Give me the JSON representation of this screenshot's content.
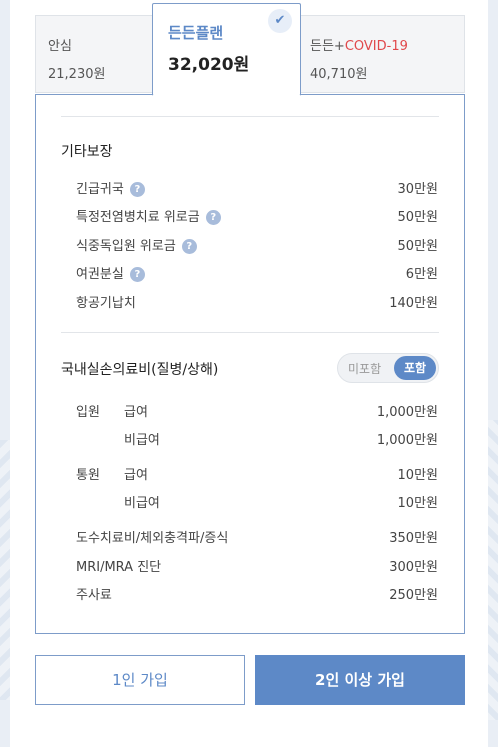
{
  "plans": [
    {
      "name": "안심",
      "price": "21,230원"
    },
    {
      "name": "든든플랜",
      "price": "32,020원",
      "selected": true
    },
    {
      "name_prefix": "든든+",
      "name_highlight": "COVID-19",
      "price": "40,710원"
    }
  ],
  "other": {
    "title": "기타보장",
    "items": [
      {
        "label": "긴급귀국",
        "value": "30만원",
        "help": "?"
      },
      {
        "label": "특정전염병치료 위로금",
        "value": "50만원",
        "help": "?"
      },
      {
        "label": "식중독입원 위로금",
        "value": "50만원",
        "help": "?"
      },
      {
        "label": "여권분실",
        "value": "6만원",
        "help": "?"
      },
      {
        "label": "항공기납치",
        "value": "140만원"
      }
    ]
  },
  "domestic": {
    "title": "국내실손의료비(질병/상해)",
    "toggle": {
      "off_label": "미포함",
      "on_label": "포함",
      "selected": "포함"
    },
    "inpatient_label": "입원",
    "outpatient_label": "통원",
    "covered_label": "급여",
    "noncovered_label": "비급여",
    "inpatient_covered": "1,000만원",
    "inpatient_noncovered": "1,000만원",
    "outpatient_covered": "10만원",
    "outpatient_noncovered": "10만원",
    "extra": [
      {
        "label": "도수치료비/체외충격파/증식",
        "value": "350만원"
      },
      {
        "label": "MRI/MRA 진단",
        "value": "300만원"
      },
      {
        "label": "주사료",
        "value": "250만원"
      }
    ]
  },
  "buttons": {
    "single": "1인 가입",
    "multi": "2인 이상 가입"
  },
  "colors": {
    "accent": "#5d89c7",
    "covid": "#e0484b"
  },
  "icons": {
    "selected": "check-icon",
    "help": "help-icon"
  }
}
